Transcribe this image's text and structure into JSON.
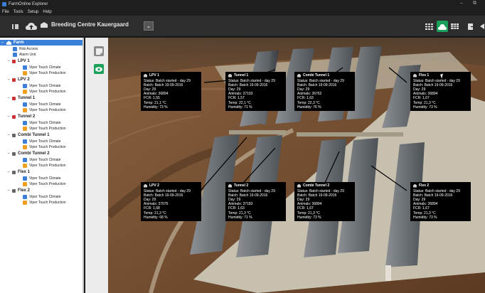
{
  "window": {
    "title": "FarmOnline Explorer",
    "controls": "– ⧉"
  },
  "menu": [
    "File",
    "Tools",
    "Setup",
    "Help"
  ],
  "toolbar": {
    "farm_name": "Breeding Centre Kauergaard",
    "dropdown_glyph": "⌄"
  },
  "accent": "#1aa05a",
  "tree": [
    {
      "label": "Farm",
      "level": 0,
      "icon": "farm",
      "selected": true,
      "expander": "−"
    },
    {
      "label": "Rob Access",
      "level": 1,
      "icon": "blue"
    },
    {
      "label": "Alarm Unit",
      "level": 1,
      "icon": "blue"
    },
    {
      "label": "LPV 1",
      "level": 1,
      "icon": "red",
      "bold": true,
      "expander": "−"
    },
    {
      "label": "Viper Touch Climate",
      "level": 2,
      "icon": "blue"
    },
    {
      "label": "Viper Touch Production",
      "level": 2,
      "icon": "orange"
    },
    {
      "label": "LPV 2",
      "level": 1,
      "icon": "red",
      "bold": true,
      "expander": "−"
    },
    {
      "label": "Viper Touch Climate",
      "level": 2,
      "icon": "blue"
    },
    {
      "label": "Viper Touch Production",
      "level": 2,
      "icon": "orange"
    },
    {
      "label": "Tunnel 1",
      "level": 1,
      "icon": "red",
      "bold": true,
      "expander": "−"
    },
    {
      "label": "Viper Touch Climate",
      "level": 2,
      "icon": "blue"
    },
    {
      "label": "Viper Touch Production",
      "level": 2,
      "icon": "orange"
    },
    {
      "label": "Tunnel 2",
      "level": 1,
      "icon": "red",
      "bold": true,
      "expander": "−"
    },
    {
      "label": "Viper Touch Climate",
      "level": 2,
      "icon": "blue"
    },
    {
      "label": "Viper Touch Production",
      "level": 2,
      "icon": "orange"
    },
    {
      "label": "Combi Tunnel 1",
      "level": 1,
      "icon": "gray",
      "bold": true,
      "expander": "−"
    },
    {
      "label": "Viper Touch Climate",
      "level": 2,
      "icon": "blue"
    },
    {
      "label": "Viper Touch Production",
      "level": 2,
      "icon": "orange"
    },
    {
      "label": "Combi Tunnel 2",
      "level": 1,
      "icon": "gray",
      "bold": true,
      "expander": "−"
    },
    {
      "label": "Viper Touch Climate",
      "level": 2,
      "icon": "blue"
    },
    {
      "label": "Viper Touch Production",
      "level": 2,
      "icon": "orange"
    },
    {
      "label": "Flex 1",
      "level": 1,
      "icon": "gray",
      "bold": true,
      "expander": "−"
    },
    {
      "label": "Viper Touch Climate",
      "level": 2,
      "icon": "blue"
    },
    {
      "label": "Viper Touch Production",
      "level": 2,
      "icon": "orange"
    },
    {
      "label": "Flex 2",
      "level": 1,
      "icon": "gray",
      "bold": true,
      "expander": "−"
    },
    {
      "label": "Viper Touch Climate",
      "level": 2,
      "icon": "blue"
    },
    {
      "label": "Viper Touch Production",
      "level": 2,
      "icon": "orange"
    }
  ],
  "houses": [
    {
      "name": "LPV 1",
      "status": "Status: Batch started - day 29",
      "batch": "Batch: Batch 19-09-2016",
      "day": "Day: 29",
      "animals": "Animals: 36894",
      "fcr": "FCR: 1,55",
      "temp": "Temp: 21,1 °C",
      "humidity": "Humidity: 73 %"
    },
    {
      "name": "Tunnel 1",
      "status": "Status: Batch started - day 29",
      "batch": "Batch: Batch 19-09-2016",
      "day": "Day: 29",
      "animals": "Animals: 37193",
      "fcr": "FCR: 1,57",
      "temp": "Temp: 22,1 °C",
      "humidity": "Humidity: 71 %"
    },
    {
      "name": "Combi Tunnel 1",
      "status": "Status: Batch started - day 29",
      "batch": "Batch: Batch 19-09-2016",
      "day": "Day: 29",
      "animals": "Animals: 36762",
      "fcr": "FCR: 1,63",
      "temp": "Temp: 22,3 °C",
      "humidity": "Humidity: 76 %"
    },
    {
      "name": "Flex 1",
      "status": "Status: Batch started - day 29",
      "batch": "Batch: Batch 19-09-2016",
      "day": "Day: 29",
      "animals": "Animals: 36894",
      "fcr": "FCR: 1,67",
      "temp": "Temp: 21,3 °C",
      "humidity": "Humidity: 73 %"
    },
    {
      "name": "LPV 2",
      "status": "Status: Batch started - day 29",
      "batch": "Batch: Batch 19-09-2016",
      "day": "Day: 29",
      "animals": "Animals: 37075",
      "fcr": "FCR: 1,68",
      "temp": "Temp: 21,3 °C",
      "humidity": "Humidity: 68 %"
    },
    {
      "name": "Tunnel 2",
      "status": "Status: Batch started - day 29",
      "batch": "Batch: Batch 19-09-2016",
      "day": "Day: 29",
      "animals": "Animals: 37183",
      "fcr": "FCR: 1,63",
      "temp": "Temp: 21,3 °C",
      "humidity": "Humidity: 71 %"
    },
    {
      "name": "Combi Tunnel 2",
      "status": "Status: Batch started - day 29",
      "batch": "Batch: Batch 19-09-2016",
      "day": "Day: 29",
      "animals": "Animals: 36894",
      "fcr": "FCR: 1,67",
      "temp": "Temp: 21,3 °C",
      "humidity": "Humidity: 73 %"
    },
    {
      "name": "Flex 2",
      "status": "Status: Batch started - day 29",
      "batch": "Batch: Batch 19-09-2016",
      "day": "Day: 29",
      "animals": "Animals: 36894",
      "fcr": "FCR: 1,67",
      "temp": "Temp: 21,3 °C",
      "humidity": "Humidity: 73 %"
    }
  ]
}
